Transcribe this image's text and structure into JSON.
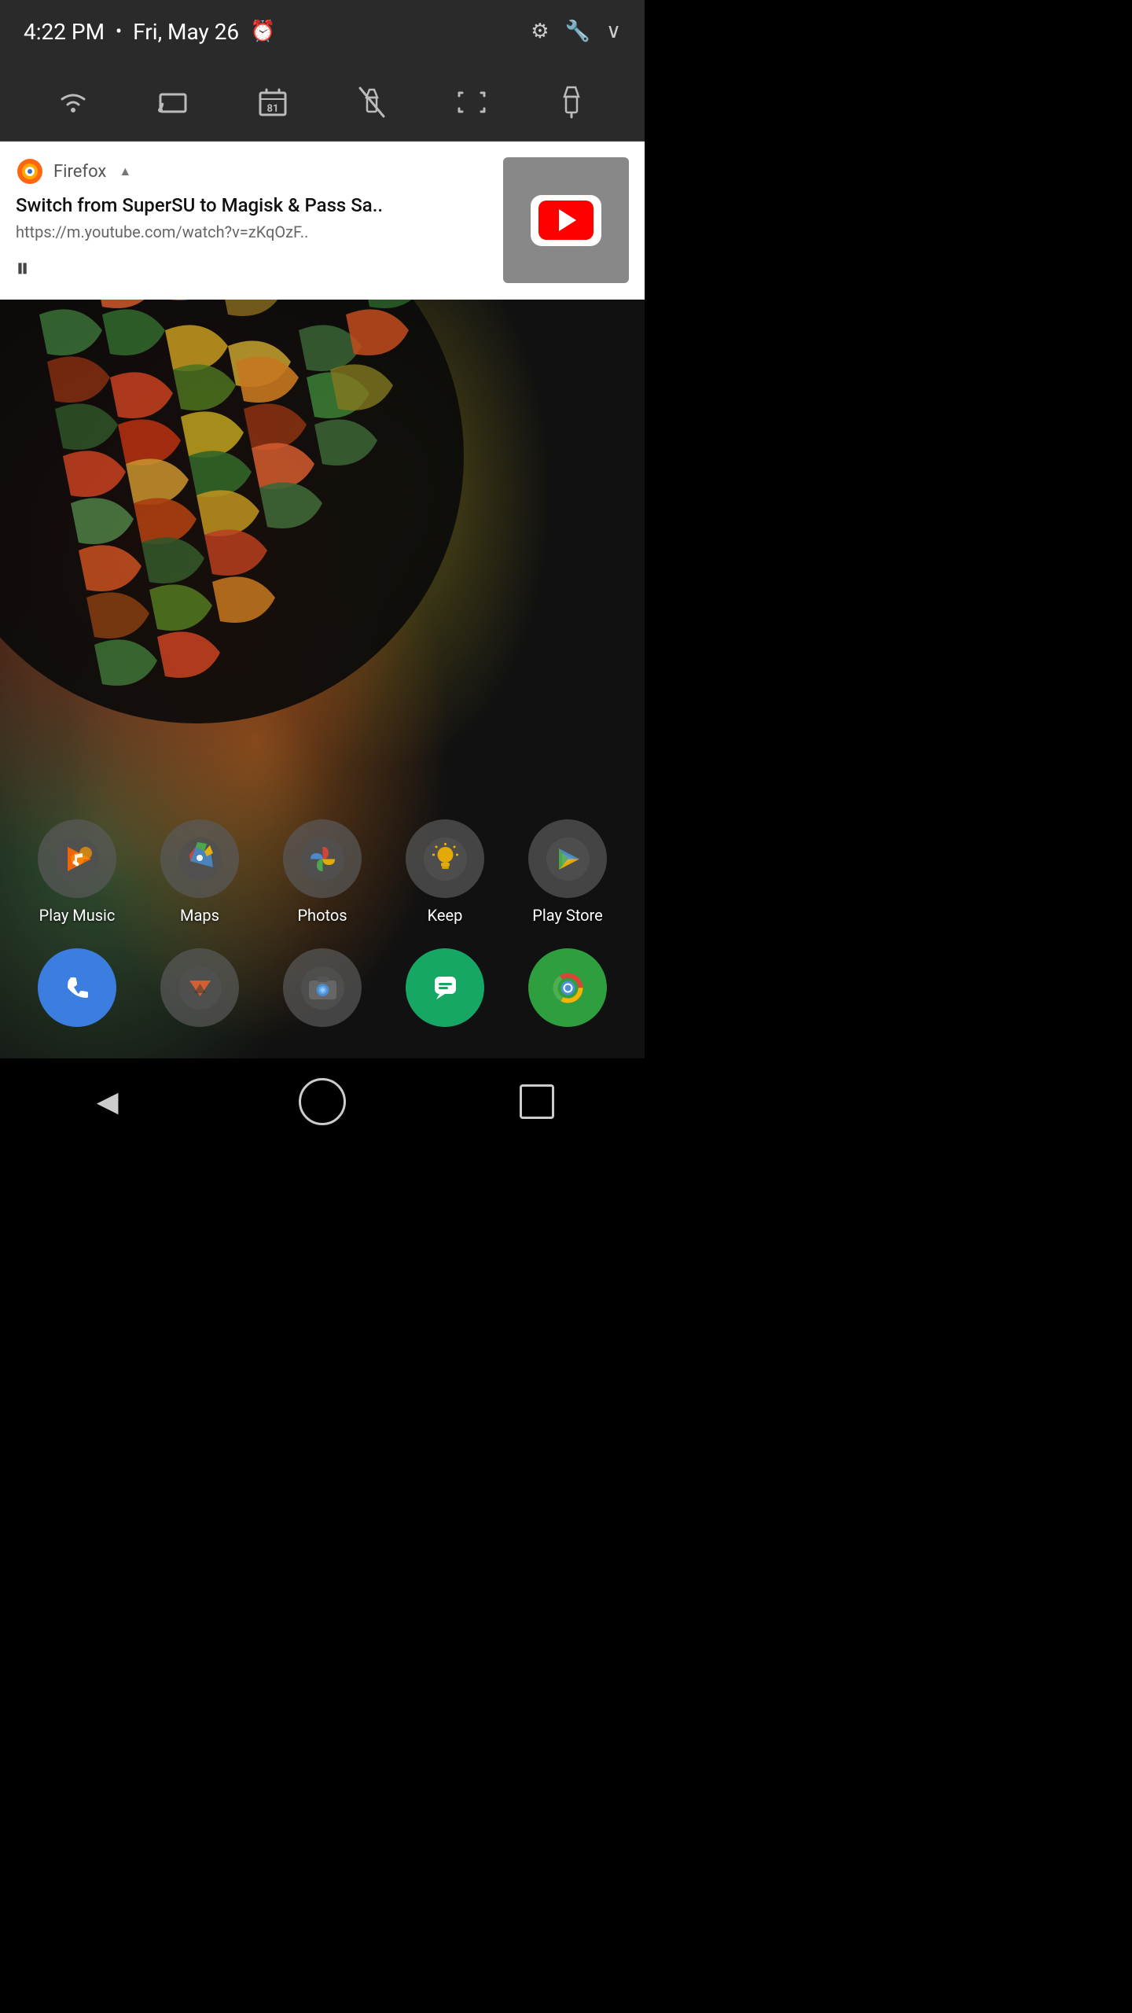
{
  "statusBar": {
    "time": "4:22 PM",
    "dot": "•",
    "date": "Fri, May 26"
  },
  "notification": {
    "appName": "Firefox",
    "expandIcon": "▲",
    "title": "Switch from SuperSU to Magisk & Pass Sa..",
    "url": "https://m.youtube.com/watch?v=zKqOzF..",
    "pauseIcon": "⏸"
  },
  "apps": {
    "row1": [
      {
        "id": "play-music",
        "label": "Play Music"
      },
      {
        "id": "maps",
        "label": "Maps"
      },
      {
        "id": "photos",
        "label": "Photos"
      },
      {
        "id": "keep",
        "label": "Keep"
      },
      {
        "id": "play-store",
        "label": "Play Store"
      }
    ],
    "row2": [
      {
        "id": "phone",
        "label": ""
      },
      {
        "id": "cyanogen",
        "label": ""
      },
      {
        "id": "camera",
        "label": ""
      },
      {
        "id": "hangouts",
        "label": ""
      },
      {
        "id": "chrome",
        "label": ""
      }
    ]
  },
  "navBar": {
    "back": "◀",
    "home": "○",
    "recents": "□"
  }
}
